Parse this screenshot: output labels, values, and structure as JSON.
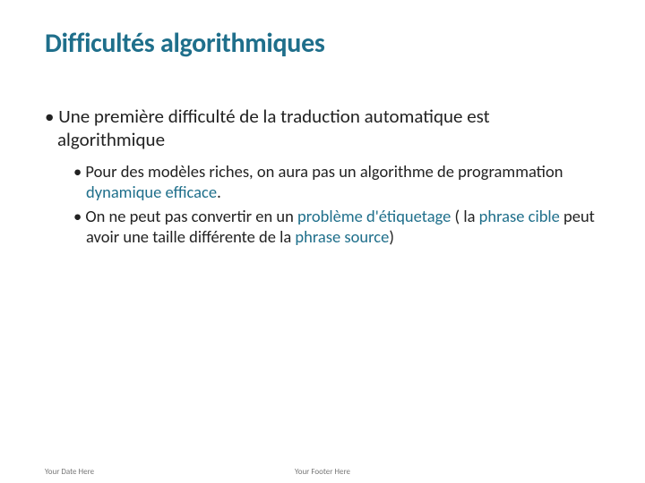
{
  "title": "Difficultés algorithmiques",
  "p1": "Une première difficulté de la traduction automatique est algorithmique",
  "p2a": "Pour des modèles riches, on aura pas un algorithme de programmation ",
  "p2b": "dynamique efficace",
  "p2c": ".",
  "p3a": "On ne peut pas convertir en un ",
  "p3b": "problème d'étiquetage",
  "p3c": " ( la ",
  "p3d": "phrase cible",
  "p3e": " peut avoir une taille différente de la ",
  "p3f": "phrase source",
  "p3g": ")",
  "footer_date": "Your Date Here",
  "footer_text": "Your Footer Here"
}
